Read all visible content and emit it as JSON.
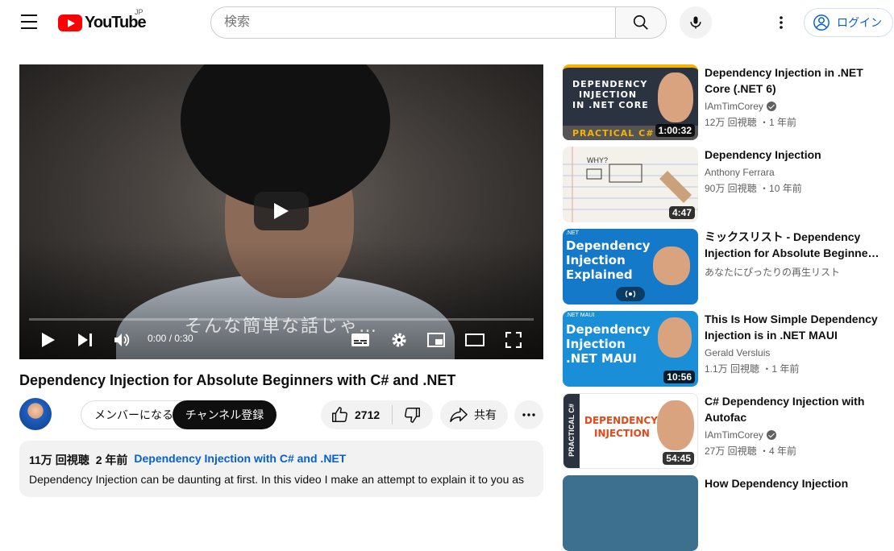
{
  "header": {
    "logo_text": "YouTube",
    "region": "JP",
    "search_placeholder": "検索",
    "login_label": "ログイン"
  },
  "player": {
    "subtitle": "そんな簡単な話じゃ…",
    "time": "0:00 / 0:30",
    "progress": 0
  },
  "video": {
    "title": "Dependency Injection for Absolute Beginners with C# and .NET",
    "member_label": "メンバーになる",
    "subscribe_label": "チャンネル登録",
    "like_count": "2712",
    "share_label": "共有",
    "views": "11万 回視聴",
    "age": "2 年前",
    "hashtag": "Dependency Injection with C# and .NET",
    "description": "Dependency Injection can be daunting at first. In this video I make an attempt to explain it to you as"
  },
  "sidebar": [
    {
      "title": "Dependency Injection in .NET Core (.NET 6)",
      "channel": "IAmTimCorey",
      "verified": true,
      "meta": "12万 回視聴 ・1 年前",
      "duration": "1:00:32",
      "thumb_lines": [
        "DEPENDENCY",
        "INJECTION",
        "IN .NET CORE"
      ],
      "thumb_footer": "PRACTICAL C#"
    },
    {
      "title": "Dependency Injection",
      "channel": "Anthony Ferrara",
      "verified": false,
      "meta": "90万 回視聴 ・10 年前",
      "duration": "4:47",
      "thumb_lines": [
        "WHY?"
      ],
      "thumb_footer": ""
    },
    {
      "title": "ミックスリスト - Dependency Injection for Absolute Beginne…",
      "channel": "あなたにぴったりの再生リスト",
      "verified": false,
      "meta": "",
      "duration": "",
      "thumb_lines": [
        "Dependency",
        "Injection",
        "Explained"
      ],
      "thumb_footer": ".NET"
    },
    {
      "title": "This Is How Simple Dependency Injection is in .NET MAUI",
      "channel": "Gerald Versluis",
      "verified": false,
      "meta": "1.1万 回視聴 ・1 年前",
      "duration": "10:56",
      "thumb_lines": [
        "Dependency",
        "Injection",
        ".NET MAUI"
      ],
      "thumb_footer": ".NET MAUI"
    },
    {
      "title": "C# Dependency Injection with Autofac",
      "channel": "IAmTimCorey",
      "verified": true,
      "meta": "27万 回視聴 ・4 年前",
      "duration": "54:45",
      "thumb_lines": [
        "DEPENDENCY",
        "INJECTION"
      ],
      "thumb_footer": "PRACTICAL C#"
    },
    {
      "title": "How Dependency Injection",
      "channel": "",
      "verified": false,
      "meta": "",
      "duration": "",
      "thumb_lines": [],
      "thumb_footer": ""
    }
  ],
  "colors": {
    "brand": "#ff0000",
    "link": "#065fd4",
    "text": "#0f0f0f",
    "muted": "#606060"
  }
}
